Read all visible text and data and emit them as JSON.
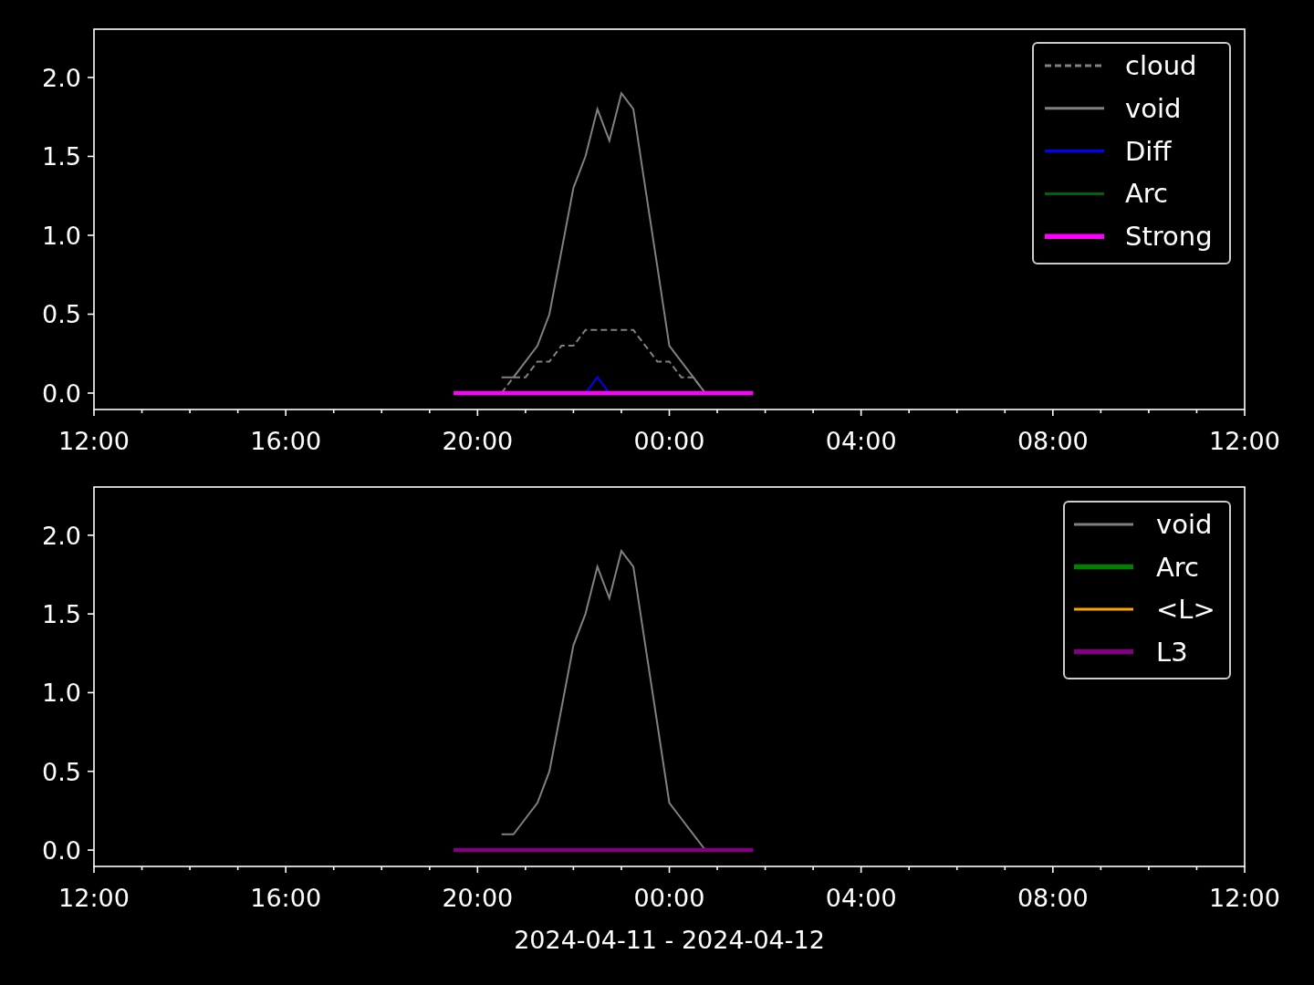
{
  "charts": [
    {
      "chart_data": {
        "type": "line",
        "legend": "upper right",
        "x": [
          "2024-04-11 19:30",
          "2024-04-11 19:45",
          "2024-04-11 20:00",
          "2024-04-11 20:15",
          "2024-04-11 20:30",
          "2024-04-11 20:45",
          "2024-04-11 21:00",
          "2024-04-11 21:15",
          "2024-04-11 21:30",
          "2024-04-11 21:45",
          "2024-04-11 22:00",
          "2024-04-11 22:15",
          "2024-04-11 22:30",
          "2024-04-11 22:45",
          "2024-04-11 23:00",
          "2024-04-11 23:15",
          "2024-04-11 23:30",
          "2024-04-11 23:45",
          "2024-04-12 00:00",
          "2024-04-12 00:15",
          "2024-04-12 00:30",
          "2024-04-12 00:45",
          "2024-04-12 01:00",
          "2024-04-12 01:15",
          "2024-04-12 01:30",
          "2024-04-12 01:45"
        ],
        "series": [
          {
            "name": "cloud",
            "color": "#808080",
            "line_style": "dashed",
            "values": [
              null,
              null,
              null,
              null,
              0,
              0.1,
              0.1,
              0.2,
              0.2,
              0.3,
              0.3,
              0.4,
              0.4,
              0.4,
              0.4,
              0.4,
              0.3,
              0.2,
              0.2,
              0.1,
              0.1,
              0,
              null,
              null,
              null,
              null
            ]
          },
          {
            "name": "void",
            "color": "#808080",
            "values": [
              null,
              null,
              null,
              null,
              0.1,
              0.1,
              0.2,
              0.3,
              0.5,
              0.9,
              1.3,
              1.5,
              1.8,
              1.6,
              1.9,
              1.8,
              1.3,
              0.8,
              0.3,
              0.2,
              0.1,
              0,
              null,
              null,
              null,
              null
            ]
          },
          {
            "name": "Diff",
            "color": "#0000ff",
            "values": [
              null,
              null,
              null,
              null,
              null,
              null,
              null,
              null,
              null,
              null,
              null,
              0,
              0.1,
              0,
              null,
              null,
              null,
              null,
              null,
              null,
              null,
              null,
              null,
              null,
              null,
              null
            ]
          },
          {
            "name": "Arc",
            "color": "#006400",
            "values": [
              null,
              null,
              null,
              null,
              null,
              null,
              null,
              null,
              null,
              null,
              null,
              null,
              null,
              null,
              null,
              null,
              null,
              null,
              null,
              null,
              null,
              null,
              null,
              null,
              null,
              null
            ]
          },
          {
            "name": "Strong",
            "color": "#ff00ff",
            "values": [
              0,
              0,
              0,
              0,
              0,
              0,
              0,
              0,
              0,
              0,
              0,
              0,
              0,
              0,
              0,
              0,
              0,
              0,
              0,
              0,
              0,
              0,
              0,
              0,
              0,
              0
            ]
          }
        ],
        "xlim": [
          "2024-04-11 12:00",
          "2024-04-12 12:00"
        ],
        "ylim": [
          -0.104,
          2.306
        ],
        "xticks": [
          {
            "value": "2024-04-11 12:00",
            "label": "12:00"
          },
          {
            "value": "2024-04-11 16:00",
            "label": "16:00"
          },
          {
            "value": "2024-04-11 20:00",
            "label": "20:00"
          },
          {
            "value": "2024-04-12 00:00",
            "label": "00:00"
          },
          {
            "value": "2024-04-12 04:00",
            "label": "04:00"
          },
          {
            "value": "2024-04-12 08:00",
            "label": "08:00"
          },
          {
            "value": "2024-04-12 12:00",
            "label": "12:00"
          }
        ],
        "yticks": [
          {
            "value": 0,
            "label": "0.0"
          },
          {
            "value": 0.5,
            "label": "0.5"
          },
          {
            "value": 1,
            "label": "1.0"
          },
          {
            "value": 1.5,
            "label": "1.5"
          },
          {
            "value": 2,
            "label": "2.0"
          }
        ]
      }
    },
    {
      "chart_data": {
        "type": "line",
        "legend": "upper right",
        "xlabel": "2024-04-11 - 2024-04-12",
        "x": [
          "2024-04-11 19:30",
          "2024-04-11 19:45",
          "2024-04-11 20:00",
          "2024-04-11 20:15",
          "2024-04-11 20:30",
          "2024-04-11 20:45",
          "2024-04-11 21:00",
          "2024-04-11 21:15",
          "2024-04-11 21:30",
          "2024-04-11 21:45",
          "2024-04-11 22:00",
          "2024-04-11 22:15",
          "2024-04-11 22:30",
          "2024-04-11 22:45",
          "2024-04-11 23:00",
          "2024-04-11 23:15",
          "2024-04-11 23:30",
          "2024-04-11 23:45",
          "2024-04-12 00:00",
          "2024-04-12 00:15",
          "2024-04-12 00:30",
          "2024-04-12 00:45",
          "2024-04-12 01:00",
          "2024-04-12 01:15",
          "2024-04-12 01:30",
          "2024-04-12 01:45"
        ],
        "series": [
          {
            "name": "void",
            "color": "#808080",
            "values": [
              null,
              null,
              null,
              null,
              0.1,
              0.1,
              0.2,
              0.3,
              0.5,
              0.9,
              1.3,
              1.5,
              1.8,
              1.6,
              1.9,
              1.8,
              1.3,
              0.8,
              0.3,
              0.2,
              0.1,
              0,
              null,
              null,
              null,
              null
            ]
          },
          {
            "name": "Arc",
            "color": "#008000",
            "values": [
              null,
              null,
              null,
              null,
              null,
              null,
              null,
              null,
              null,
              null,
              null,
              null,
              null,
              null,
              null,
              null,
              null,
              null,
              null,
              null,
              null,
              null,
              null,
              null,
              null,
              null
            ]
          },
          {
            "name": "<L>",
            "color": "#ffa500",
            "values": [
              null,
              null,
              null,
              null,
              null,
              null,
              null,
              null,
              null,
              null,
              null,
              null,
              null,
              null,
              null,
              null,
              null,
              null,
              null,
              null,
              null,
              null,
              null,
              null,
              null,
              null
            ]
          },
          {
            "name": "L3",
            "color": "#800080",
            "values": [
              0,
              0,
              0,
              0,
              0,
              0,
              0,
              0,
              0,
              0,
              0,
              0,
              0,
              0,
              0,
              0,
              0,
              0,
              0,
              0,
              0,
              0,
              0,
              0,
              0,
              0
            ]
          }
        ],
        "xlim": [
          "2024-04-11 12:00",
          "2024-04-12 12:00"
        ],
        "ylim": [
          -0.104,
          2.306
        ],
        "xticks": [
          {
            "value": "2024-04-11 12:00",
            "label": "12:00"
          },
          {
            "value": "2024-04-11 16:00",
            "label": "16:00"
          },
          {
            "value": "2024-04-11 20:00",
            "label": "20:00"
          },
          {
            "value": "2024-04-12 00:00",
            "label": "00:00"
          },
          {
            "value": "2024-04-12 04:00",
            "label": "04:00"
          },
          {
            "value": "2024-04-12 08:00",
            "label": "08:00"
          },
          {
            "value": "2024-04-12 12:00",
            "label": "12:00"
          }
        ],
        "yticks": [
          {
            "value": 0,
            "label": "0.0"
          },
          {
            "value": 0.5,
            "label": "0.5"
          },
          {
            "value": 1,
            "label": "1.0"
          },
          {
            "value": 1.5,
            "label": "1.5"
          },
          {
            "value": 2,
            "label": "2.0"
          }
        ]
      }
    }
  ]
}
